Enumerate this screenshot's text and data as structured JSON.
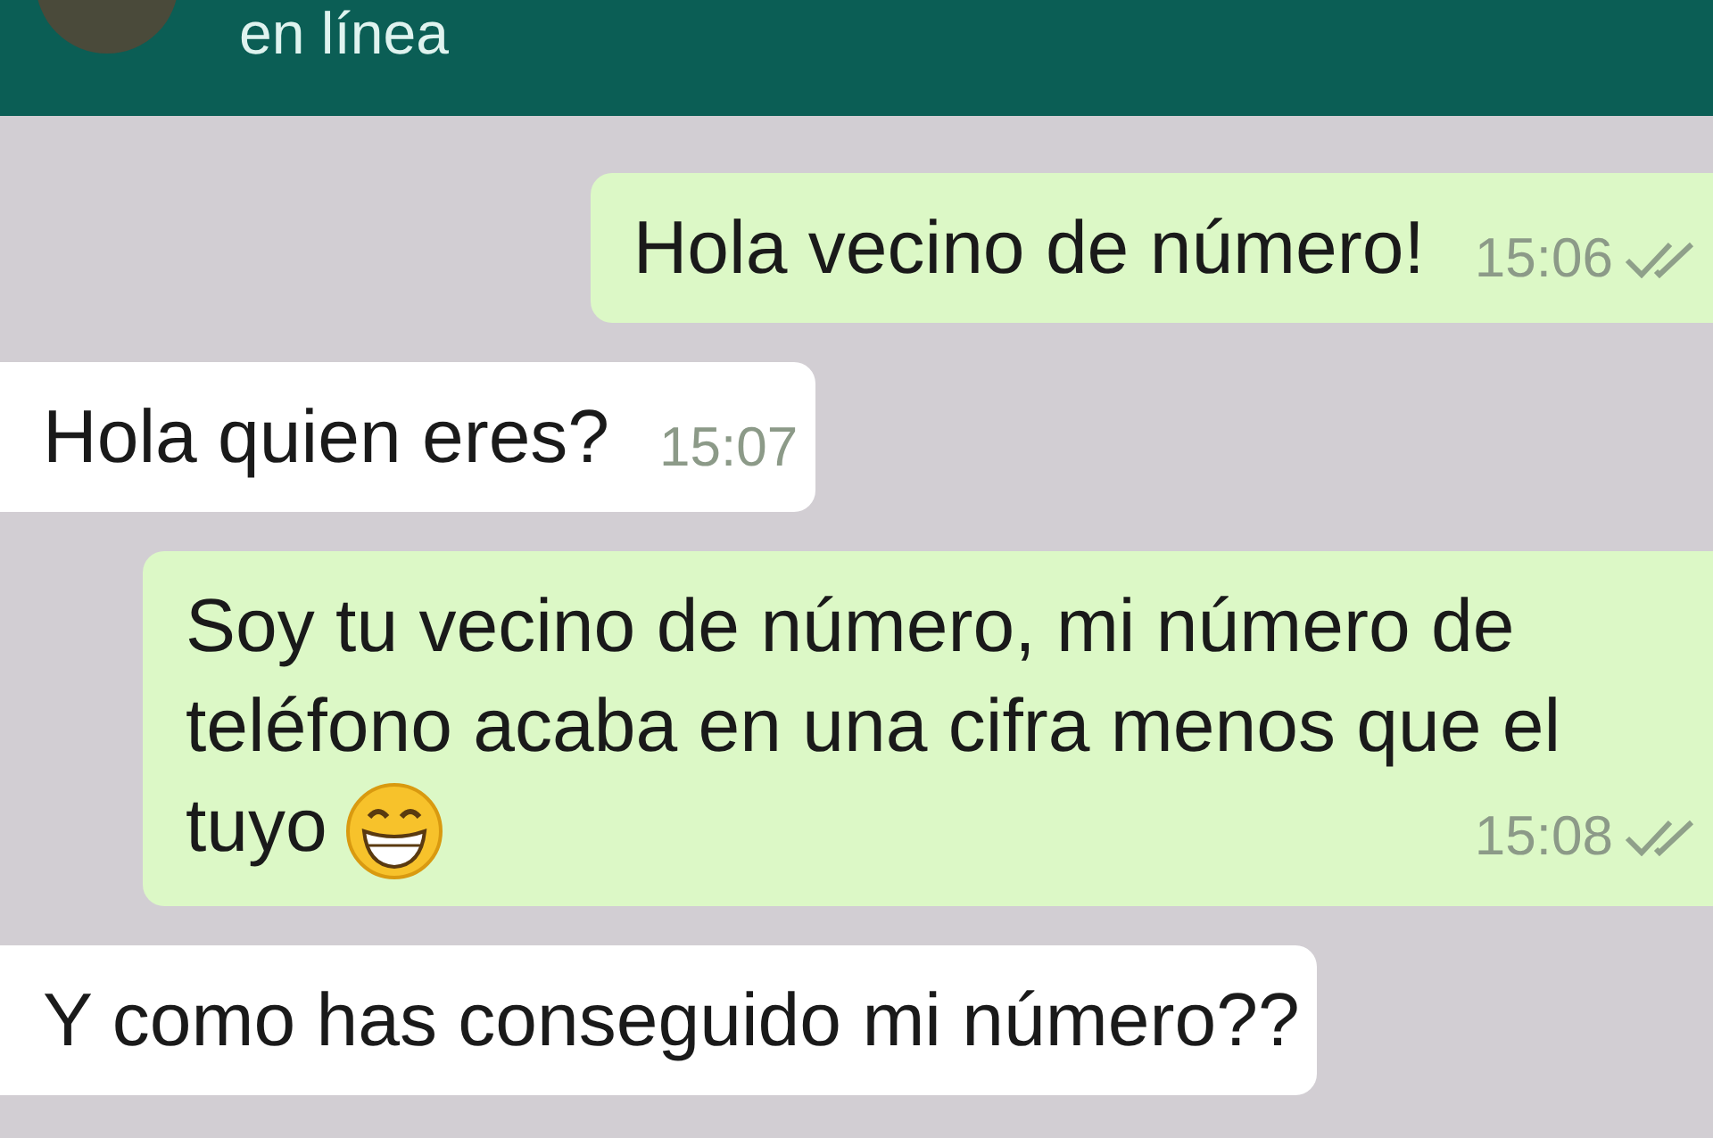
{
  "header": {
    "status": "en línea"
  },
  "messages": [
    {
      "kind": "outgoing",
      "text": "Hola vecino de número!",
      "time": "15:06",
      "delivered": true
    },
    {
      "kind": "incoming",
      "text": "Hola quien eres?",
      "time": "15:07"
    },
    {
      "kind": "outgoing",
      "text": "Soy tu vecino de número, mi número de teléfono acaba en una cifra menos que el tuyo",
      "emoji": true,
      "time": "15:08",
      "delivered": true
    },
    {
      "kind": "incoming",
      "text": "Y como has conseguido mi número??"
    }
  ]
}
